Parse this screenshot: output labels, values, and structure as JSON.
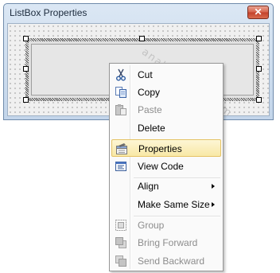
{
  "window": {
    "title": "ListBox Properties",
    "close_label": "✕"
  },
  "watermark": "analysistabs.com",
  "menu": {
    "items": [
      {
        "label": "Cut",
        "icon": "scissors-icon"
      },
      {
        "label": "Copy",
        "icon": "copy-icon"
      },
      {
        "label": "Paste",
        "icon": "paste-icon"
      },
      {
        "label": "Delete",
        "icon": ""
      },
      {
        "label": "Properties",
        "icon": "properties-icon"
      },
      {
        "label": "View Code",
        "icon": "view-code-icon"
      },
      {
        "label": "Align",
        "icon": ""
      },
      {
        "label": "Make Same Size",
        "icon": ""
      },
      {
        "label": "Group",
        "icon": "group-icon"
      },
      {
        "label": "Bring Forward",
        "icon": "bring-forward-icon"
      },
      {
        "label": "Send Backward",
        "icon": "send-backward-icon"
      }
    ]
  },
  "colors": {
    "highlight_fill": "#f8e8a6",
    "highlight_border": "#e5c365",
    "disabled_text": "#8d8d8d",
    "titlebar": "#c3d5ea"
  }
}
